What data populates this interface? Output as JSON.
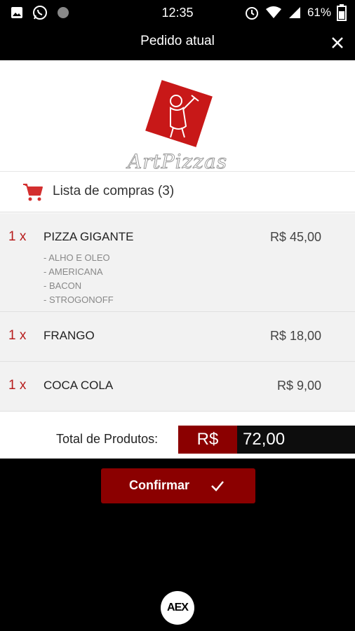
{
  "status_bar": {
    "time": "12:35",
    "battery": "61%",
    "icons_left": [
      "image-icon",
      "whatsapp-icon",
      "circle-icon"
    ],
    "icons_right": [
      "alarm-icon",
      "wifi-icon",
      "signal-icon",
      "battery-icon"
    ]
  },
  "modal": {
    "title": "Pedido atual",
    "logo_text": "ArtPizzas"
  },
  "cart": {
    "label": "Lista de compras",
    "count": "(3)"
  },
  "items": [
    {
      "qty": "1 x",
      "name": "PIZZA GIGANTE",
      "price": "R$ 45,00",
      "options": [
        "- ALHO E OLEO",
        "- AMERICANA",
        "- BACON",
        "- STROGONOFF"
      ]
    },
    {
      "qty": "1 x",
      "name": "FRANGO",
      "price": "R$ 18,00",
      "options": []
    },
    {
      "qty": "1 x",
      "name": "COCA COLA",
      "price": "R$ 9,00",
      "options": []
    }
  ],
  "total": {
    "label": "Total de Produtos:",
    "currency": "R$",
    "value": "72,00"
  },
  "confirm": {
    "label": "Confirmar"
  },
  "brand": {
    "text": "AEX"
  },
  "colors": {
    "accent": "#8b0000",
    "qty_red": "#b71c1c",
    "logo_red": "#c81818"
  }
}
